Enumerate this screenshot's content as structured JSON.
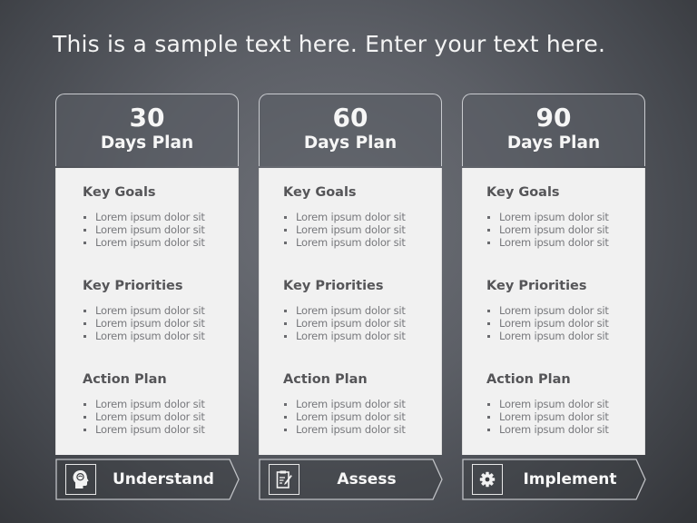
{
  "slide": {
    "title": "This is a sample text here. Enter your text here."
  },
  "columns": [
    {
      "number": "30",
      "subtitle": "Days Plan",
      "sections": [
        {
          "title": "Key Goals",
          "items": [
            "Lorem ipsum  dolor sit",
            "Lorem ipsum  dolor sit",
            "Lorem ipsum  dolor sit"
          ]
        },
        {
          "title": "Key Priorities",
          "items": [
            "Lorem ipsum  dolor sit",
            "Lorem ipsum  dolor sit",
            "Lorem ipsum  dolor sit"
          ]
        },
        {
          "title": "Action Plan",
          "items": [
            "Lorem ipsum  dolor sit",
            "Lorem ipsum  dolor sit",
            "Lorem ipsum  dolor sit"
          ]
        }
      ],
      "tag": {
        "label": "Understand",
        "icon": "head-brain-icon"
      }
    },
    {
      "number": "60",
      "subtitle": "Days Plan",
      "sections": [
        {
          "title": "Key Goals",
          "items": [
            "Lorem ipsum  dolor sit",
            "Lorem ipsum  dolor sit",
            "Lorem ipsum  dolor sit"
          ]
        },
        {
          "title": "Key Priorities",
          "items": [
            "Lorem ipsum  dolor sit",
            "Lorem ipsum  dolor sit",
            "Lorem ipsum  dolor sit"
          ]
        },
        {
          "title": "Action Plan",
          "items": [
            "Lorem ipsum  dolor sit",
            "Lorem ipsum  dolor sit",
            "Lorem ipsum  dolor sit"
          ]
        }
      ],
      "tag": {
        "label": "Assess",
        "icon": "clipboard-pencil-icon"
      }
    },
    {
      "number": "90",
      "subtitle": "Days Plan",
      "sections": [
        {
          "title": "Key Goals",
          "items": [
            "Lorem ipsum  dolor sit",
            "Lorem ipsum  dolor sit",
            "Lorem ipsum  dolor sit"
          ]
        },
        {
          "title": "Key Priorities",
          "items": [
            "Lorem ipsum  dolor sit",
            "Lorem ipsum  dolor sit",
            "Lorem ipsum  dolor sit"
          ]
        },
        {
          "title": "Action Plan",
          "items": [
            "Lorem ipsum  dolor sit",
            "Lorem ipsum  dolor sit",
            "Lorem ipsum  dolor sit"
          ]
        }
      ],
      "tag": {
        "label": "Implement",
        "icon": "gear-icon"
      }
    }
  ],
  "colors": {
    "background_center": "#6e7178",
    "background_edge": "#333539",
    "panel": "#f1f1f1",
    "heading_text": "#555558",
    "body_text": "#77787c",
    "light_text": "#f6f6f6",
    "outline": "#c9cbcf"
  }
}
